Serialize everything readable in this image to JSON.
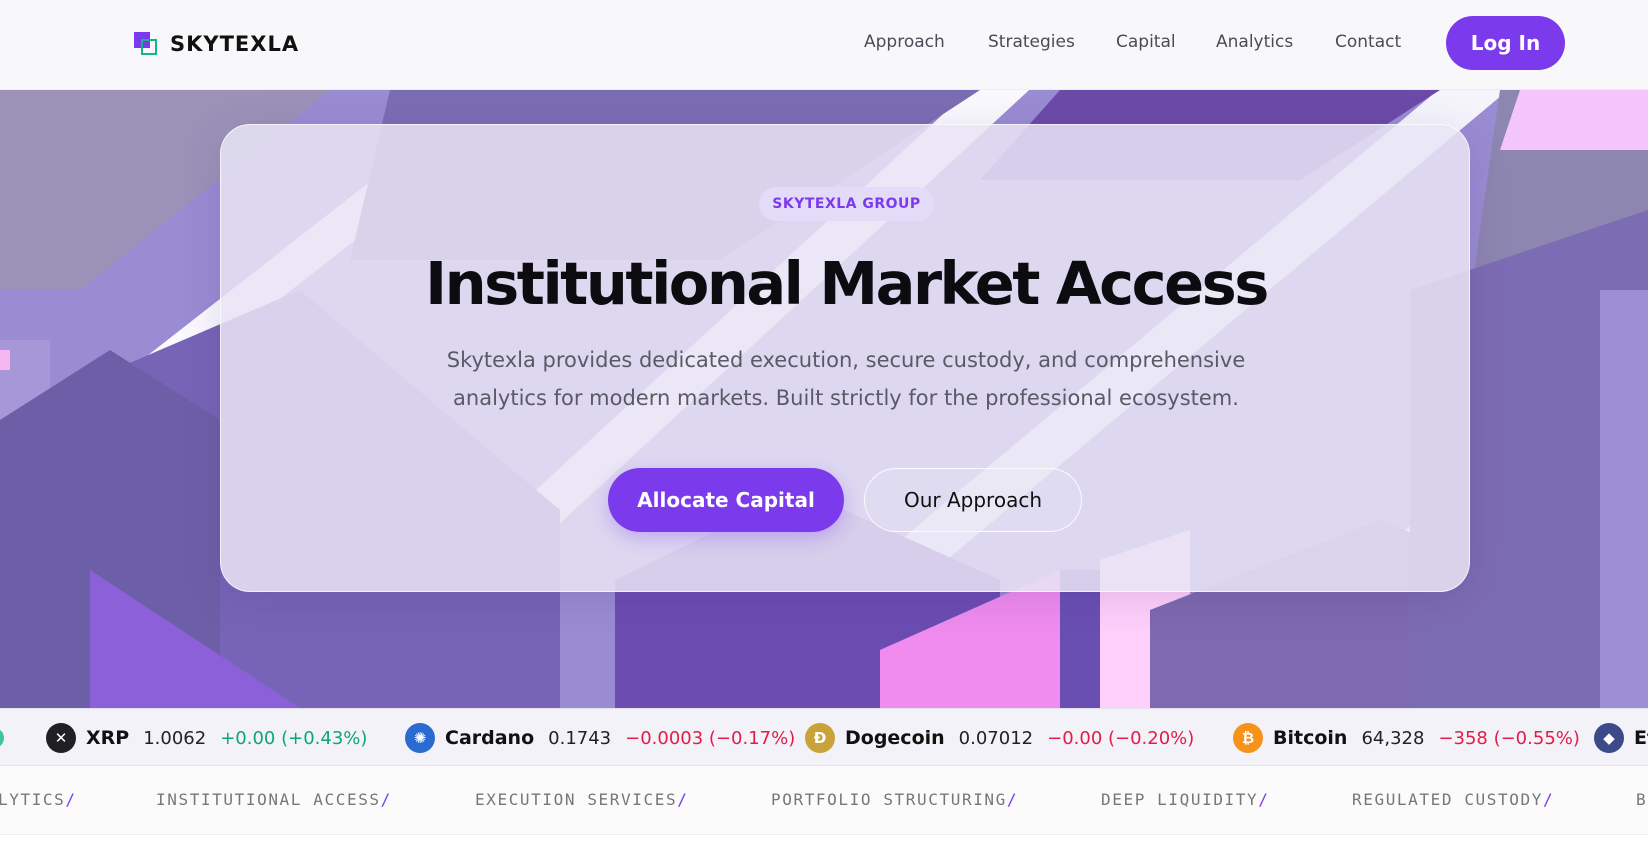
{
  "brand": {
    "name": "SKYTEXLA",
    "accent": "#7c3aed",
    "accent_secondary": "#10b981"
  },
  "nav": {
    "links": [
      "Approach",
      "Strategies",
      "Capital",
      "Analytics",
      "Contact"
    ],
    "login_label": "Log In"
  },
  "hero": {
    "badge": "SKYTEXLA GROUP",
    "title": "Institutional Market Access",
    "subtitle_line1": "Skytexla provides dedicated execution, secure custody, and comprehensive",
    "subtitle_line2": "analytics for modern markets. Built strictly for the professional ecosystem.",
    "primary_cta": "Allocate Capital",
    "secondary_cta": "Our Approach"
  },
  "ticker": [
    {
      "name": "XRP",
      "price": "1.0062",
      "change": "+0.00 (+0.43%)",
      "direction": "up",
      "icon": "xrp-icon",
      "icon_color": "#1f1f24",
      "glyph": "✕"
    },
    {
      "name": "Cardano",
      "price": "0.1743",
      "change": "−0.0003 (−0.17%)",
      "direction": "down",
      "icon": "cardano-icon",
      "icon_color": "#2a6bd1",
      "glyph": "✺"
    },
    {
      "name": "Dogecoin",
      "price": "0.07012",
      "change": "−0.00 (−0.20%)",
      "direction": "down",
      "icon": "dogecoin-icon",
      "icon_color": "#c9a33a",
      "glyph": "Ð"
    },
    {
      "name": "Bitcoin",
      "price": "64,328",
      "change": "−358 (−0.55%)",
      "direction": "down",
      "icon": "bitcoin-icon",
      "icon_color": "#f7931a",
      "glyph": "₿"
    },
    {
      "name": "Et",
      "price": "",
      "change": "",
      "direction": "",
      "icon": "ethereum-icon",
      "icon_color": "#3c4a8a",
      "glyph": "◆"
    }
  ],
  "services": [
    "LYTICS",
    "INSTITUTIONAL ACCESS",
    "EXECUTION SERVICES",
    "PORTFOLIO STRUCTURING",
    "DEEP LIQUIDITY",
    "REGULATED CUSTODY",
    "B"
  ]
}
